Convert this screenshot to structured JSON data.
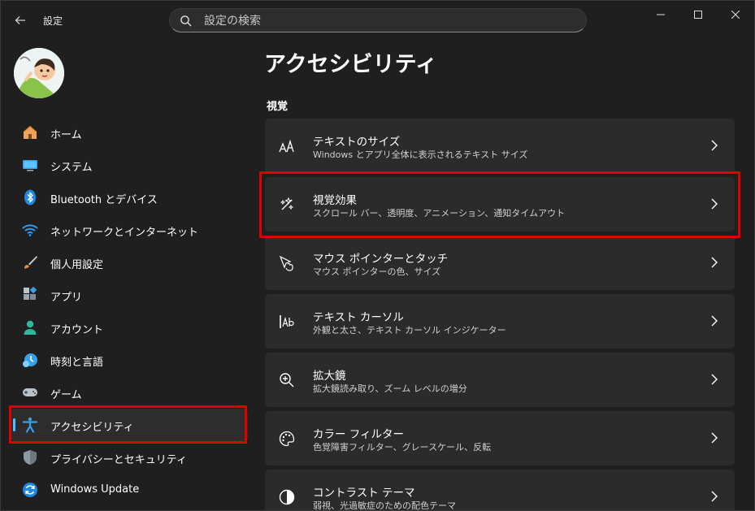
{
  "app": {
    "title": "設定"
  },
  "search": {
    "placeholder": "設定の検索"
  },
  "window_controls": {
    "minimize": "minimize-icon",
    "maximize": "maximize-icon",
    "close": "close-icon"
  },
  "sidebar": {
    "items": [
      {
        "label": "ホーム",
        "icon": "home-icon"
      },
      {
        "label": "システム",
        "icon": "system-icon"
      },
      {
        "label": "Bluetooth とデバイス",
        "icon": "bluetooth-icon"
      },
      {
        "label": "ネットワークとインターネット",
        "icon": "wifi-icon"
      },
      {
        "label": "個人用設定",
        "icon": "brush-icon"
      },
      {
        "label": "アプリ",
        "icon": "apps-icon"
      },
      {
        "label": "アカウント",
        "icon": "account-icon"
      },
      {
        "label": "時刻と言語",
        "icon": "time-language-icon"
      },
      {
        "label": "ゲーム",
        "icon": "gamepad-icon"
      },
      {
        "label": "アクセシビリティ",
        "icon": "accessibility-icon",
        "selected": true
      },
      {
        "label": "プライバシーとセキュリティ",
        "icon": "shield-icon"
      },
      {
        "label": "Windows Update",
        "icon": "update-icon"
      }
    ]
  },
  "main": {
    "title": "アクセシビリティ",
    "section": "視覚",
    "cards": [
      {
        "title": "テキストのサイズ",
        "subtitle": "Windows とアプリ全体に表示されるテキスト サイズ",
        "icon": "text-size-icon"
      },
      {
        "title": "視覚効果",
        "subtitle": "スクロール バー、透明度、アニメーション、通知タイムアウト",
        "icon": "visual-effects-icon"
      },
      {
        "title": "マウス ポインターとタッチ",
        "subtitle": "マウス ポインターの色、サイズ",
        "icon": "mouse-pointer-icon"
      },
      {
        "title": "テキスト カーソル",
        "subtitle": "外観と太さ、テキスト カーソル インジケーター",
        "icon": "text-cursor-icon"
      },
      {
        "title": "拡大鏡",
        "subtitle": "拡大鏡読み取り、ズーム レベルの増分",
        "icon": "magnifier-icon"
      },
      {
        "title": "カラー フィルター",
        "subtitle": "色覚障害フィルター、グレースケール、反転",
        "icon": "color-filter-icon"
      },
      {
        "title": "コントラスト テーマ",
        "subtitle": "弱視、光過敏症のための配色テーマ",
        "icon": "contrast-icon"
      }
    ]
  },
  "colors": {
    "accent": "#4cc2ff",
    "highlight": "#e00000",
    "background": "#1f1f1f",
    "card": "#2b2b2b"
  }
}
